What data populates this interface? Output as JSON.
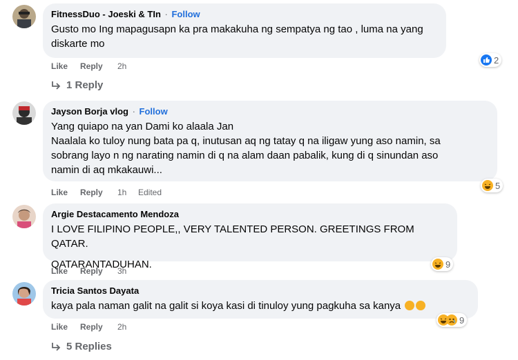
{
  "comments": [
    {
      "author": "FitnessDuo - Joeski & TIn",
      "follow": "Follow",
      "lines": [
        "Gusto mo Ing mapagusapn ka pra makakuha ng sempatya ng tao , luma na yang",
        "diskarte mo"
      ],
      "like": "Like",
      "reply": "Reply",
      "time": "2h",
      "edited": "",
      "reaction_count": "2",
      "reaction_type": "like",
      "replies": "1 Reply"
    },
    {
      "author": "Jayson Borja vlog",
      "follow": "Follow",
      "lines": [
        "Yang quiapo na yan Dami ko alaala Jan",
        "Naalala ko tuloy nung bata pa q, inutusan aq ng tatay q na iligaw yung aso namin, sa",
        "sobrang layo n ng narating namin di q na alam daan pabalik, kung di q sinundan aso",
        "namin di aq mkakauwi..."
      ],
      "like": "Like",
      "reply": "Reply",
      "time": "1h",
      "edited": "Edited",
      "reaction_count": "5",
      "reaction_type": "haha",
      "replies": ""
    },
    {
      "author": "Argie Destacamento Mendoza",
      "follow": "",
      "lines": [
        "I LOVE FILIPINO PEOPLE,, VERY TALENTED PERSON. GREETINGS FROM QATAR.",
        "QATARANTADUHAN."
      ],
      "like": "Like",
      "reply": "Reply",
      "time": "3h",
      "edited": "",
      "reaction_count": "9",
      "reaction_type": "haha",
      "replies": ""
    },
    {
      "author": "Tricia Santos Dayata",
      "follow": "",
      "lines": [
        "kaya pala naman galit na galit si koya kasi di tinuloy yung pagkuha sa kanya"
      ],
      "like": "Like",
      "reply": "Reply",
      "time": "2h",
      "edited": "",
      "reaction_count": "9",
      "reaction_type": "haha-sad",
      "replies": "5 Replies"
    }
  ],
  "colors": {
    "follow": "#216fdb",
    "bubble": "#f0f2f5",
    "meta": "#65676b",
    "like": "#1877f2",
    "haha": "#f7b125"
  },
  "icons": {
    "reply_arrow": "reply-arrow-icon",
    "like_reaction": "like-reaction-icon",
    "haha_reaction": "haha-reaction-icon"
  }
}
